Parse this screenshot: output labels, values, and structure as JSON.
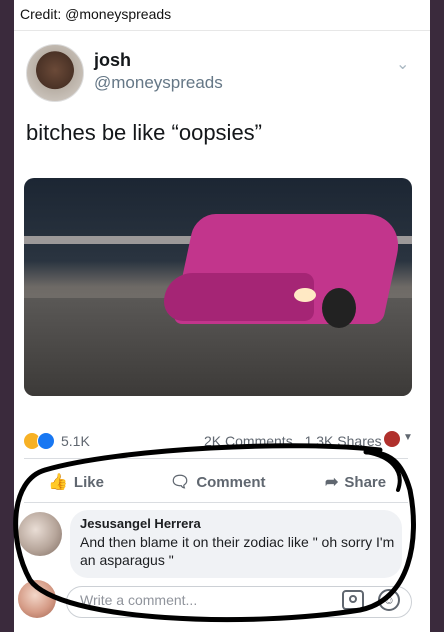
{
  "credit": "Credit: @moneyspreads",
  "tweet": {
    "name": "josh",
    "handle": "@moneyspreads",
    "text": "bitches be like “oopsies”"
  },
  "post": {
    "reaction_count": "5.1K",
    "comments": "2K Comments",
    "shares": "1.3K Shares"
  },
  "actions": {
    "like": "Like",
    "comment": "Comment",
    "share": "Share"
  },
  "comment": {
    "author": "Jesusangel Herrera",
    "text": "And then blame it on their zodiac like \" oh sorry I'm an asparagus \""
  },
  "composer": {
    "placeholder": "Write a comment..."
  },
  "icons": [
    "chevron-down-icon",
    "haha-reaction-icon",
    "like-reaction-icon",
    "globe-icon",
    "like-icon",
    "comment-icon",
    "share-icon",
    "camera-icon",
    "emoji-icon"
  ],
  "colors": {
    "ink_circle": "#000000",
    "facebook_blue": "#1877f2",
    "text_gray": "#606770"
  }
}
